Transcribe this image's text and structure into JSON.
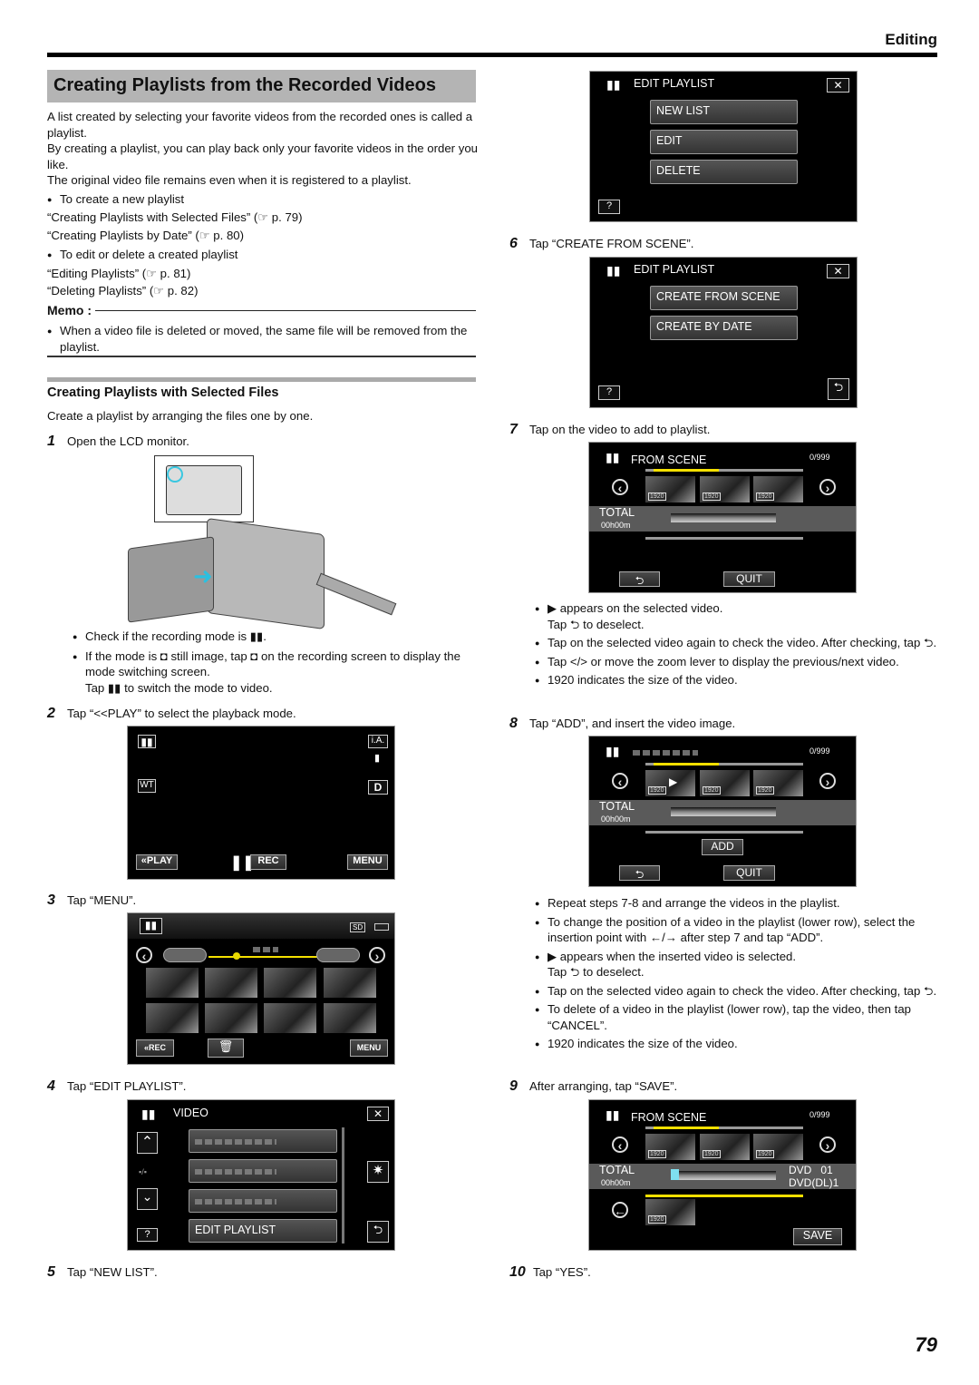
{
  "header": {
    "section": "Editing"
  },
  "title": "Creating Playlists from the Recorded Videos",
  "intro": [
    "A list created by selecting your favorite videos from the recorded ones is called a playlist.",
    "By creating a playlist, you can play back only your favorite videos in the order you like.",
    "The original video file remains even when it is registered to a playlist."
  ],
  "links": {
    "new_heading": "To create a new playlist",
    "new_1": "“Creating Playlists with Selected Files” (☞ p. 79)",
    "new_2": "“Creating Playlists by Date” (☞ p. 80)",
    "edit_heading": "To edit or delete a created playlist",
    "edit_1": "“Editing Playlists” (☞ p. 81)",
    "edit_2": "“Deleting Playlists” (☞ p. 82)"
  },
  "memo": {
    "label": "Memo :",
    "text": "When a video file is deleted or moved, the same file will be removed from the playlist."
  },
  "subsection": {
    "title": "Creating Playlists with Selected Files",
    "desc": "Create a playlist by arranging the files one by one."
  },
  "steps": {
    "s1": {
      "num": "1",
      "text": "Open the LCD monitor.",
      "notes": [
        "Check if the recording mode is ▮▮.",
        "If the mode is ◘ still image, tap ◘ on the recording screen to display the mode switching screen.",
        "Tap ▮▮ to switch the mode to video."
      ]
    },
    "s2": {
      "num": "2",
      "text": "Tap “<<PLAY” to select the playback mode."
    },
    "s3": {
      "num": "3",
      "text": "Tap “MENU”."
    },
    "s4": {
      "num": "4",
      "text": "Tap “EDIT PLAYLIST”."
    },
    "s5": {
      "num": "5",
      "text": "Tap “NEW LIST”."
    },
    "s6": {
      "num": "6",
      "text": "Tap “CREATE FROM SCENE”."
    },
    "s7": {
      "num": "7",
      "text": "Tap on the video to add to playlist.",
      "notes": [
        "▶ appears on the selected video.",
        "Tap ⮌ to deselect.",
        "Tap on the selected video again to check the video. After checking, tap ⮌.",
        "Tap </> or move the zoom lever to display the previous/next video.",
        "1920 indicates the size of the video."
      ]
    },
    "s8": {
      "num": "8",
      "text": "Tap “ADD”, and insert the video image.",
      "notes": [
        "Repeat steps 7-8 and arrange the videos in the playlist.",
        "To change the position of a video in the playlist (lower row), select the insertion point with ←/→ after step 7 and tap “ADD”.",
        "▶ appears when the inserted video is selected.",
        "Tap ⮌ to deselect.",
        "Tap on the selected video again to check the video. After checking, tap ⮌.",
        "To delete of a video in the playlist (lower row), tap the video, then tap “CANCEL”.",
        "1920 indicates the size of the video."
      ]
    },
    "s9": {
      "num": "9",
      "text": "After arranging, tap “SAVE”."
    },
    "s10": {
      "num": "10",
      "text": "Tap “YES”."
    }
  },
  "screen_rec": {
    "ia": "i.A.",
    "wt": "WT",
    "d": "D",
    "play": "«PLAY",
    "rec": "REC",
    "menu": "MENU"
  },
  "screen_index": {
    "sd": "SD",
    "rec": "«REC",
    "menu": "MENU"
  },
  "screen_video_menu": {
    "title": "VIDEO",
    "item": "EDIT PLAYLIST",
    "help": "?",
    "close": "✕"
  },
  "screen_edit_playlist": {
    "title": "EDIT PLAYLIST",
    "items": [
      "NEW LIST",
      "EDIT",
      "DELETE"
    ],
    "help": "?",
    "close": "✕"
  },
  "screen_create": {
    "title": "EDIT PLAYLIST",
    "items": [
      "CREATE FROM SCENE",
      "CREATE BY DATE"
    ],
    "help": "?",
    "close": "✕"
  },
  "screen_scene": {
    "title": "FROM SCENE",
    "count": "0/999",
    "total": "TOTAL",
    "time": "00h00m",
    "quit": "QUIT",
    "add": "ADD",
    "save": "SAVE",
    "size": "1920",
    "dvd": "DVD   01",
    "dvddl": "DVD(DL)1"
  },
  "page_number": "79"
}
